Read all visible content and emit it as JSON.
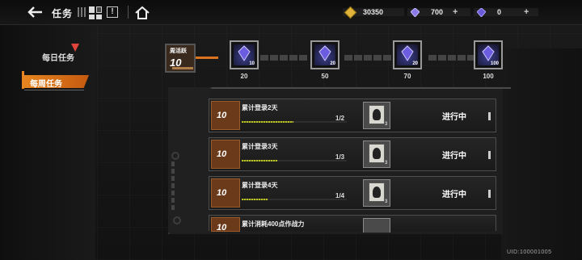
{
  "topbar": {
    "title": "任务",
    "currency_coin": "30350",
    "currency_crystal": "700",
    "currency_premium": "0",
    "plus_label": "+"
  },
  "sidebar": {
    "daily_label": "每日任务",
    "weekly_label": "每周任务"
  },
  "activity": {
    "label": "周活跃",
    "value": "10",
    "milestones": [
      {
        "threshold": "20",
        "qty": "10"
      },
      {
        "threshold": "50",
        "qty": "20"
      },
      {
        "threshold": "70",
        "qty": "20"
      },
      {
        "threshold": "100",
        "qty": "100"
      }
    ]
  },
  "tasks": [
    {
      "points": "10",
      "name": "累计登录2天",
      "progress": "1/2",
      "reward_qty": "3",
      "status": "进行中"
    },
    {
      "points": "10",
      "name": "累计登录3天",
      "progress": "1/3",
      "reward_qty": "3",
      "status": "进行中"
    },
    {
      "points": "10",
      "name": "累计登录4天",
      "progress": "1/4",
      "reward_qty": "3",
      "status": "进行中"
    },
    {
      "points": "10",
      "name": "累计消耗400点作战力",
      "progress": "",
      "reward_qty": "",
      "status": ""
    }
  ],
  "footer": {
    "uid": "UID:100001005"
  },
  "colors": {
    "accent": "#e58420",
    "progress": "#b8c42a",
    "points_bg": "#6b3a1a"
  }
}
